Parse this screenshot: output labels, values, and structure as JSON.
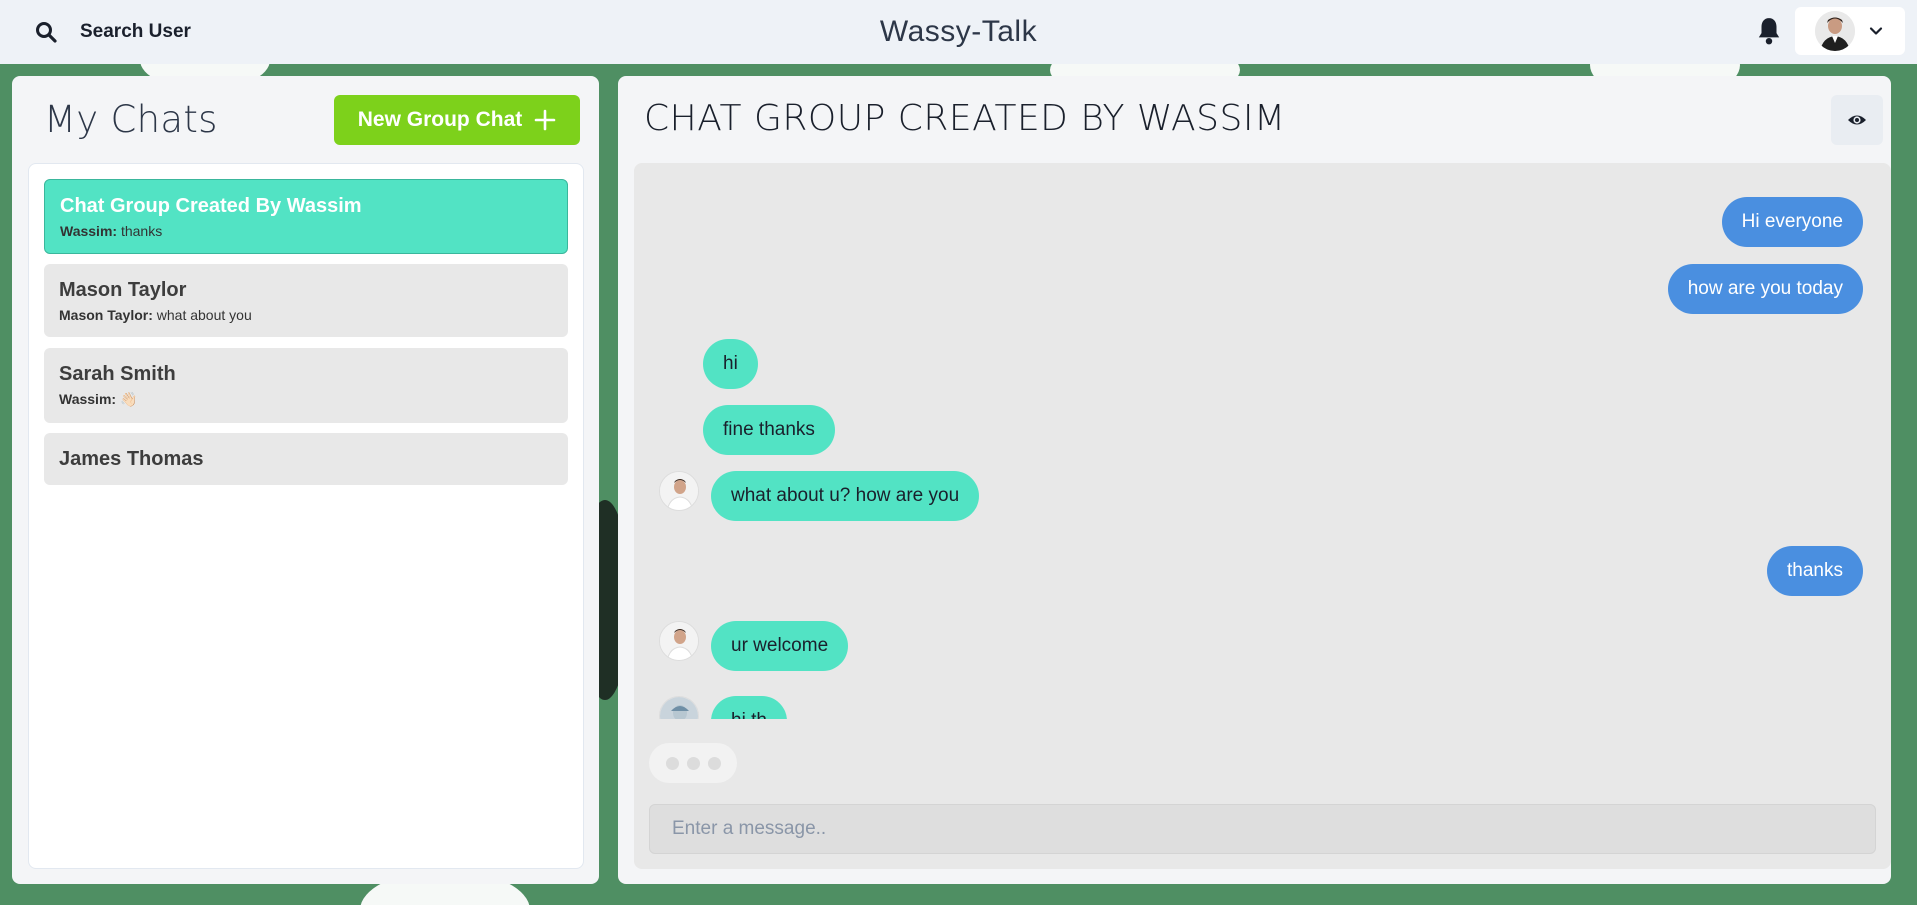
{
  "header": {
    "search_label": "Search User",
    "app_title": "Wassy-Talk",
    "icons": [
      "search-icon",
      "bell-icon",
      "chevron-down-icon"
    ]
  },
  "sidebar": {
    "title": "My Chats",
    "new_group_label": "New Group Chat",
    "chats": [
      {
        "name": "Chat Group Created By Wassim",
        "sender": "Wassim:",
        "latest": "thanks",
        "active": true
      },
      {
        "name": "Mason Taylor",
        "sender": "Mason Taylor:",
        "latest": "what about you",
        "active": false
      },
      {
        "name": "Sarah Smith",
        "sender": "Wassim:",
        "latest": "👋🏻",
        "active": false
      },
      {
        "name": "James Thomas",
        "sender": "",
        "latest": "",
        "active": false
      }
    ]
  },
  "chat": {
    "title": "CHAT GROUP CREATED BY WASSIM",
    "messages": [
      {
        "text": "Hi everyone",
        "mine": true
      },
      {
        "text": "how are you today",
        "mine": true
      },
      {
        "text": "hi",
        "mine": false
      },
      {
        "text": "fine thanks",
        "mine": false
      },
      {
        "text": "what about u? how are you",
        "mine": false
      },
      {
        "text": "thanks",
        "mine": true
      },
      {
        "text": "ur welcome",
        "mine": false
      },
      {
        "text": "hi th",
        "mine": false
      }
    ],
    "input_placeholder": "Enter a message.."
  },
  "colors": {
    "accent_green": "#7dd11b",
    "active_chat": "#52e3c4",
    "my_message": "#4a8fe0",
    "their_message": "#52e3c4",
    "background": "#4f8f63"
  }
}
